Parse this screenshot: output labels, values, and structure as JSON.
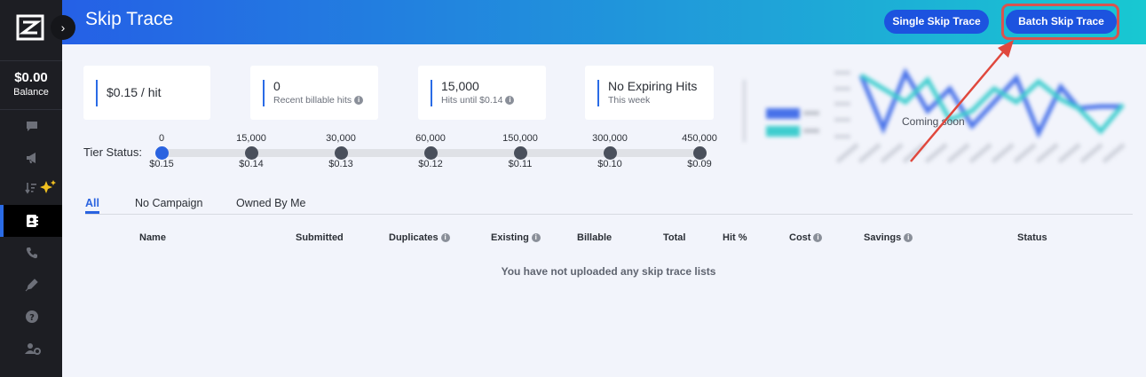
{
  "sidebar": {
    "balance_amount": "$0.00",
    "balance_label": "Balance",
    "expand_icon": "›",
    "items": [
      {
        "name": "messages-icon"
      },
      {
        "name": "megaphone-icon"
      },
      {
        "name": "sort-sparkle-icon"
      },
      {
        "name": "contact-book-icon",
        "active": true
      },
      {
        "name": "phone-icon"
      },
      {
        "name": "pencil-icon"
      },
      {
        "name": "help-icon"
      },
      {
        "name": "user-settings-icon"
      }
    ]
  },
  "header": {
    "title": "Skip Trace",
    "single_button": "Single Skip Trace",
    "batch_button": "Batch Skip Trace"
  },
  "stats": [
    {
      "value": "$0.15 / hit",
      "sub": ""
    },
    {
      "value": "0",
      "sub": "Recent billable hits"
    },
    {
      "value": "15,000",
      "sub": "Hits until $0.14"
    },
    {
      "value": "No Expiring Hits",
      "sub": "This week"
    }
  ],
  "tier": {
    "label": "Tier Status:",
    "current_index": 0,
    "levels": [
      {
        "hits": "0",
        "price": "$0.15"
      },
      {
        "hits": "15,000",
        "price": "$0.14"
      },
      {
        "hits": "30,000",
        "price": "$0.13"
      },
      {
        "hits": "60,000",
        "price": "$0.12"
      },
      {
        "hits": "150,000",
        "price": "$0.11"
      },
      {
        "hits": "300,000",
        "price": "$0.10"
      },
      {
        "hits": "450,000",
        "price": "$0.09"
      }
    ]
  },
  "chart_placeholder": {
    "text": "Coming soon",
    "colors": {
      "series_a": "#2a5be6",
      "series_b": "#1fc7c7"
    }
  },
  "tabs": [
    "All",
    "No Campaign",
    "Owned By Me"
  ],
  "table": {
    "columns": [
      "Name",
      "Submitted",
      "Duplicates",
      "Existing",
      "Billable",
      "Total",
      "Hit %",
      "Cost",
      "Savings",
      "Status"
    ],
    "empty_message": "You have not uploaded any skip trace lists"
  },
  "colors": {
    "accent": "#2a63e0",
    "sidebar_bg": "#1d1e23",
    "highlight": "#d9534f"
  }
}
